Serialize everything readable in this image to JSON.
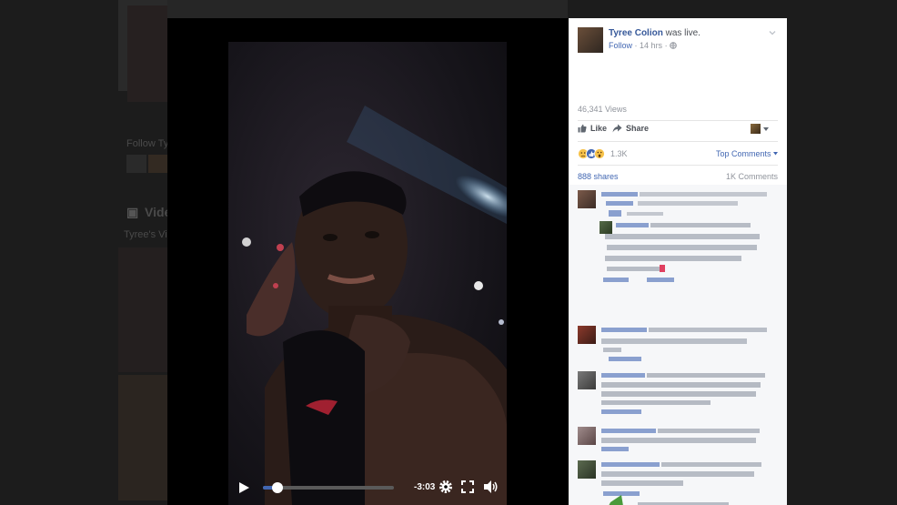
{
  "post": {
    "poster_name": "Tyree Colion",
    "action_text": "was live.",
    "follow_label": "Follow",
    "separator": "·",
    "time_ago": "14 hrs",
    "privacy_icon": "globe-icon",
    "views": "46,341 Views"
  },
  "actions": {
    "like_label": "Like",
    "share_label": "Share"
  },
  "engagement": {
    "reaction_count": "1.3K",
    "sort_label": "Top Comments",
    "shares": "888 shares",
    "comments": "1K Comments"
  },
  "video": {
    "time_remaining": "-3:03",
    "progress": 0.11
  },
  "background_page": {
    "follow_text": "Follow Ty",
    "section_title": "Vide",
    "section_sub": "Tyree's Vide"
  },
  "colors": {
    "link": "#365899",
    "accent": "#4267b2",
    "muted": "#90949c",
    "panel_bg": "#ffffff",
    "comments_bg": "#f6f7f9"
  }
}
